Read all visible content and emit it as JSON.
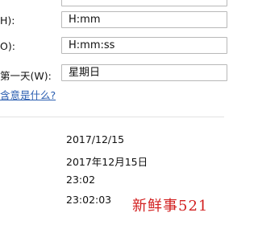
{
  "settings": {
    "short_time": {
      "label": "H):",
      "value": "H:mm"
    },
    "long_time": {
      "label": "O):",
      "value": "H:mm:ss"
    },
    "first_day": {
      "label": "第一天(W):",
      "value": "星期日"
    }
  },
  "help_link": "含意是什么?",
  "examples": {
    "short_date": "2017/12/15",
    "long_date": "2017年12月15日",
    "short_time": "23:02",
    "long_time": "23:02:03"
  },
  "watermark": "新鲜事521"
}
